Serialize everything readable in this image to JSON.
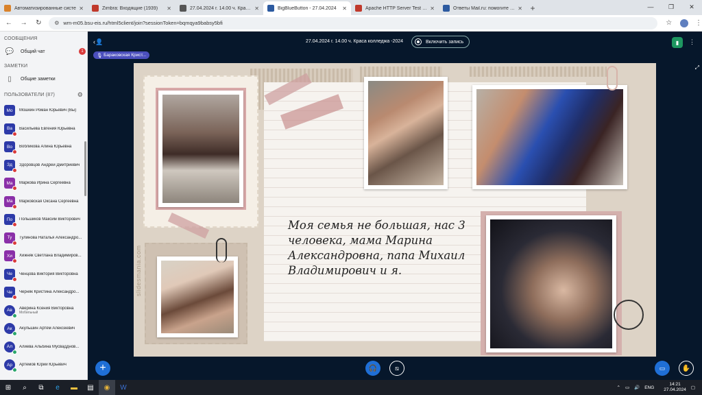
{
  "browser": {
    "tabs": [
      {
        "title": "Автоматизированные систе",
        "color": "#d9822b"
      },
      {
        "title": "Zimbra: Входящие (1939)",
        "color": "#c0392b"
      },
      {
        "title": "27.04.2024 г. 14.00 ч. Краса ко",
        "color": "#555555"
      },
      {
        "title": "BigBlueButton - 27.04.2024",
        "color": "#2c5aa0"
      },
      {
        "title": "Apache HTTP Server Test Page",
        "color": "#c0392b"
      },
      {
        "title": "Ответы Mail.ru: помогите пл",
        "color": "#2c5aa0"
      }
    ],
    "url": "wm-m05.bsu-eis.ru/html5client/join?sessionToken=bqmqya9babsy5bfi"
  },
  "sidebar": {
    "messages_header": "СООБЩЕНИЯ",
    "public_chat": "Общий чат",
    "chat_badge": "1",
    "notes_header": "ЗАМЕТКИ",
    "shared_notes": "Общие заметки",
    "users_header": "ПОЛЬЗОВАТЕЛИ (87)",
    "users": [
      {
        "initials": "Мо",
        "name": "Мошкин Роман Юрьевич (Вы)",
        "color": "#2d3aa8",
        "shape": "square",
        "mic": "none"
      },
      {
        "initials": "Ва",
        "name": "Васильева Евгения Юрьевна",
        "color": "#2d3aa8",
        "shape": "square",
        "mic": "red"
      },
      {
        "initials": "Во",
        "name": "Вобликова Алина Юрьевна",
        "color": "#2d3aa8",
        "shape": "square",
        "mic": "red"
      },
      {
        "initials": "Зд",
        "name": "Здоровцов Андрей Дмитриевич",
        "color": "#2d3aa8",
        "shape": "square",
        "mic": "red"
      },
      {
        "initials": "Ма",
        "name": "Маркова Ирина Сергеевна",
        "color": "#8a2fa8",
        "shape": "square",
        "mic": "red"
      },
      {
        "initials": "Ма",
        "name": "Марковская Оксана Сергеевна",
        "color": "#8a2fa8",
        "shape": "square",
        "mic": "red"
      },
      {
        "initials": "По",
        "name": "Польшиков Максим Викторович",
        "color": "#2d3aa8",
        "shape": "square",
        "mic": "red"
      },
      {
        "initials": "Ту",
        "name": "Тулинова Наталья Александро...",
        "color": "#8a2fa8",
        "shape": "square",
        "mic": "red"
      },
      {
        "initials": "Хи",
        "name": "Хижняк Светлана Владимиров...",
        "color": "#8a2fa8",
        "shape": "square",
        "mic": "red"
      },
      {
        "initials": "Че",
        "name": "Ченцова Виктория Викторовна",
        "color": "#2d3aa8",
        "shape": "square",
        "mic": "red"
      },
      {
        "initials": "Че",
        "name": "Черняк Кристина Александро...",
        "color": "#2d3aa8",
        "shape": "square",
        "mic": "red"
      },
      {
        "initials": "Ав",
        "name": "Аверина Ксения Викторовна",
        "sub": "Мобильный",
        "color": "#2d3aa8",
        "shape": "round",
        "mic": "green"
      },
      {
        "initials": "Ак",
        "name": "Акульшин Артём Алексеевич",
        "color": "#2d3aa8",
        "shape": "round",
        "mic": "green"
      },
      {
        "initials": "Ал",
        "name": "Алиева Альбина Мусвадднов...",
        "color": "#2d3aa8",
        "shape": "round",
        "mic": "green"
      },
      {
        "initials": "Ар",
        "name": "Артемов Юрий Юрьевич",
        "color": "#2d3aa8",
        "shape": "round",
        "mic": "green"
      }
    ]
  },
  "meeting": {
    "title": "27.04.2024 г. 14.00 ч. Краса колледжа -2024",
    "record_label": "Включить запись",
    "talking": "Бараковская Крист..."
  },
  "slide": {
    "text": "Моя семья не большая, нас 3 человека, мама Марина Александровна, папа Михаил Владимирович и я.",
    "watermark": "slidesmania.com"
  },
  "taskbar": {
    "lang": "ENG",
    "time": "14:21",
    "date": "27.04.2024"
  }
}
